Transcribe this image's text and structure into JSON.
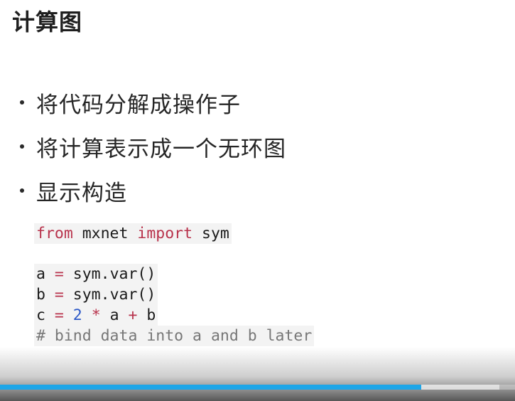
{
  "slide": {
    "title": "计算图",
    "bullets": [
      "将代码分解成操作子",
      "将计算表示成一个无环图",
      "显示构造"
    ],
    "code": {
      "import_line": {
        "kw_from": "from",
        "module": " mxnet ",
        "kw_import": "import",
        "name": " sym"
      },
      "line_a": {
        "lhs": "a ",
        "eq": "=",
        "rhs": " sym.var()"
      },
      "line_b": {
        "lhs": "b ",
        "eq": "=",
        "rhs": " sym.var()"
      },
      "line_c": {
        "lhs": "c ",
        "eq": "=",
        "sp1": " ",
        "num": "2",
        "sp2": " ",
        "mul": "*",
        "var_a": " a ",
        "plus": "+",
        "var_b": " b"
      },
      "comment": "# bind data into a and b later"
    }
  },
  "player": {
    "progress": 0.818,
    "buffered": 0.97,
    "progress_color": "#1ea6e8"
  }
}
